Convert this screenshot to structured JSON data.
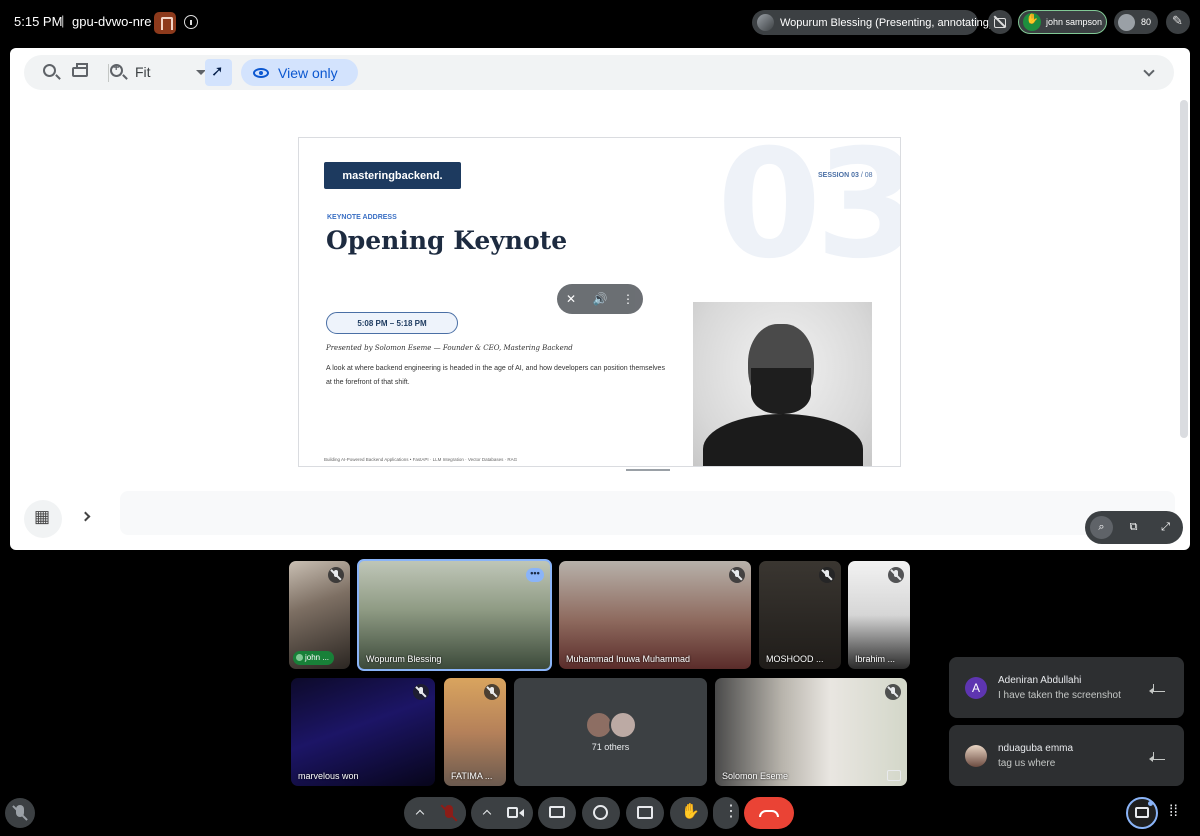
{
  "topbar": {
    "time": "5:15 PM",
    "separator": "|",
    "meeting_code": "gpu-dvwo-nre",
    "presenter_label": "Wopurum Blessing (Presenting, annotating)",
    "raised_hand_name": "john sampson",
    "participant_count": "80"
  },
  "toolbar": {
    "zoom_label": "Fit",
    "view_only_label": "View only"
  },
  "slide": {
    "logo_text": "masteringbackend.",
    "big_number": "03",
    "session_label": "SESSION 03",
    "session_sep": "/",
    "session_total": "08",
    "kicker": "KEYNOTE ADDRESS",
    "title": "Opening Keynote",
    "time_range": "5:08 PM – 5:18 PM",
    "presented_by": "Presented by Solomon Eseme — Founder & CEO, Mastering Backend",
    "description": "A look at where backend engineering is headed in the age of AI, and how developers can position themselves at the forefront of that shift.",
    "footer": "Building AI-Powered Backend Applications  •  FastAPI  ·  LLM Integration  ·  Vector Databases  ·  RAG"
  },
  "participants": {
    "row1": [
      {
        "name": "john ...",
        "muted": true,
        "hand_raised": true
      },
      {
        "name": "Wopurum Blessing",
        "muted": false,
        "speaking": true
      },
      {
        "name": "Muhammad Inuwa Muhammad",
        "muted": true
      },
      {
        "name": "MOSHOOD ...",
        "muted": true
      },
      {
        "name": "Ibrahim ...",
        "muted": true
      }
    ],
    "row2": [
      {
        "name": "marvelous won",
        "muted": true
      },
      {
        "name": "FATIMA ...",
        "muted": true
      },
      {
        "name": "",
        "others_label": "71 others"
      },
      {
        "name": "Solomon Eseme",
        "muted": true,
        "presenting": true
      }
    ]
  },
  "chat": [
    {
      "initial": "A",
      "sender": "Adeniran Abdullahi",
      "message": "I have taken the screenshot"
    },
    {
      "initial": "",
      "sender": "nduaguba emma",
      "message": "tag us where"
    }
  ],
  "colors": {
    "end_call": "#ea4335",
    "accent": "#8ab4f8",
    "raised_hand": "#81c995"
  }
}
